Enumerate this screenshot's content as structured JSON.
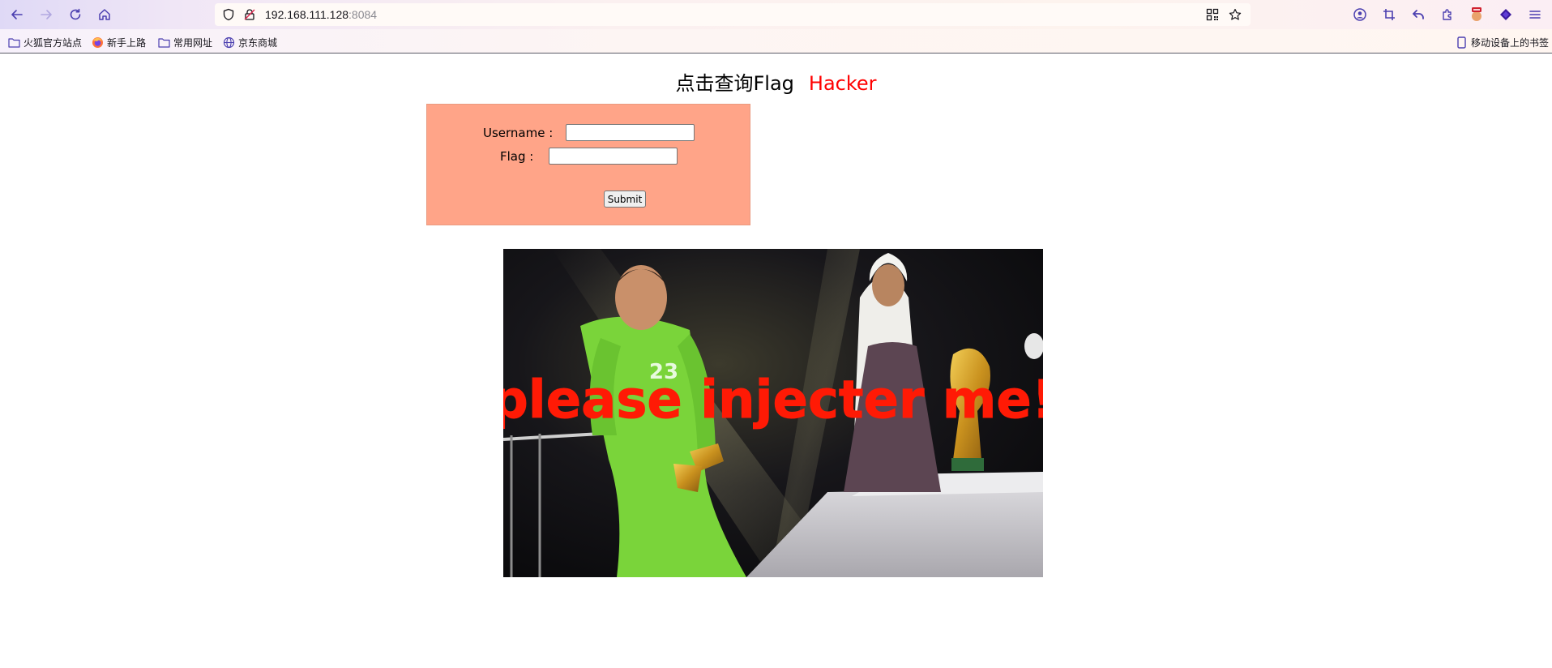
{
  "browser": {
    "url_host": "192.168.111.128",
    "url_port": ":8084",
    "bookmarks": [
      {
        "label": "火狐官方站点",
        "icon": "folder-icon"
      },
      {
        "label": "新手上路",
        "icon": "firefox-icon"
      },
      {
        "label": "常用网址",
        "icon": "folder-icon"
      },
      {
        "label": "京东商城",
        "icon": "globe-icon"
      }
    ],
    "mobile_bookmarks": "移动设备上的书签"
  },
  "page": {
    "heading": "点击查询Flag",
    "heading_accent": "Hacker",
    "accent_color": "#ff0000",
    "form": {
      "username_label": "Username :",
      "flag_label": "Flag :",
      "username_value": "",
      "flag_value": "",
      "submit_label": "Submit",
      "background": "#ffa488"
    },
    "image": {
      "caption": "please injecter me!",
      "jersey_number": "23"
    }
  }
}
